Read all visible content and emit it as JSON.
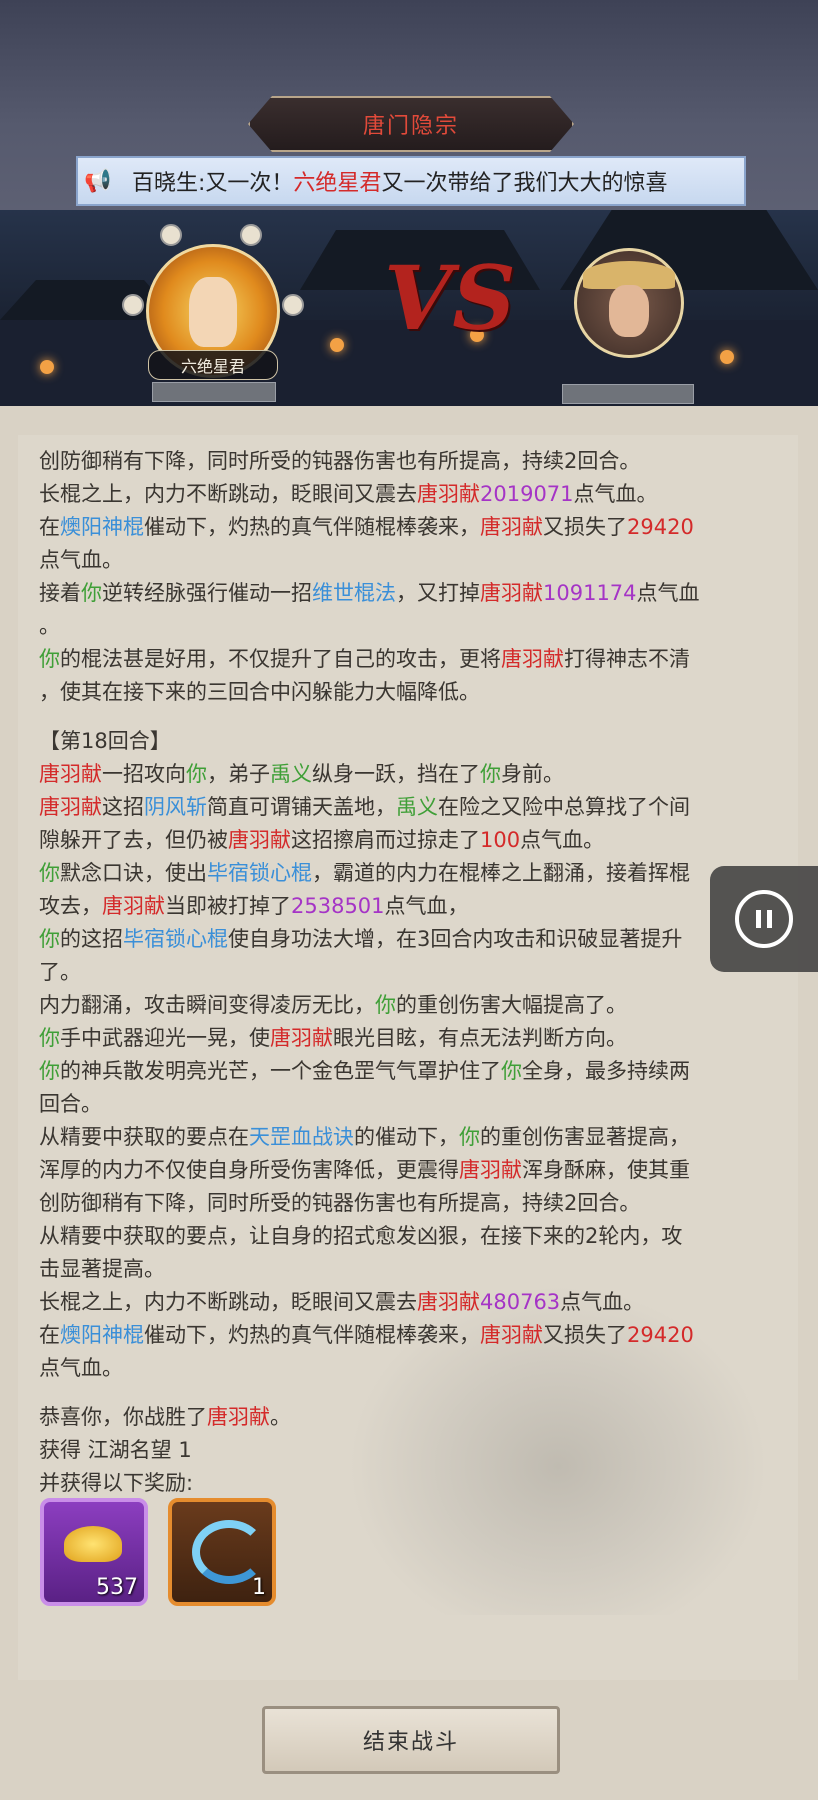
{
  "header": {
    "title": "唐门隐宗",
    "ticker_prefix": "百晓生:又一次！",
    "ticker_name": "六绝星君",
    "ticker_suffix": "又一次带给了我们大大的惊喜"
  },
  "battle": {
    "player_name": "六绝星君",
    "vs_text": "VS"
  },
  "log": {
    "lines": [
      [
        {
          "t": "创防御稍有下降，同时所受的钝器伤害也有所提高，持续2回合。",
          "c": ""
        }
      ],
      [
        {
          "t": "长棍之上，内力不断跳动，眨眼间又震去",
          "c": ""
        },
        {
          "t": "唐羽献",
          "c": "red"
        },
        {
          "t": "2019071",
          "c": "pur"
        },
        {
          "t": "点气血。",
          "c": ""
        }
      ],
      [
        {
          "t": "在",
          "c": ""
        },
        {
          "t": "燠阳神棍",
          "c": "blu"
        },
        {
          "t": "催动下，灼热的真气伴随棍棒袭来，",
          "c": ""
        },
        {
          "t": "唐羽献",
          "c": "red"
        },
        {
          "t": "又损失了",
          "c": ""
        },
        {
          "t": "29420",
          "c": "red"
        }
      ],
      [
        {
          "t": "点气血。",
          "c": ""
        }
      ],
      [
        {
          "t": "接着",
          "c": ""
        },
        {
          "t": "你",
          "c": "grn"
        },
        {
          "t": "逆转经脉强行催动一招",
          "c": ""
        },
        {
          "t": "维世棍法",
          "c": "blu"
        },
        {
          "t": "，又打掉",
          "c": ""
        },
        {
          "t": "唐羽献",
          "c": "red"
        },
        {
          "t": "1091174",
          "c": "pur"
        },
        {
          "t": "点气血",
          "c": ""
        }
      ],
      [
        {
          "t": "。",
          "c": ""
        }
      ],
      [
        {
          "t": "你",
          "c": "grn"
        },
        {
          "t": "的棍法甚是好用，不仅提升了自己的攻击，更将",
          "c": ""
        },
        {
          "t": "唐羽献",
          "c": "red"
        },
        {
          "t": "打得神志不清",
          "c": ""
        }
      ],
      [
        {
          "t": "，使其在接下来的三回合中闪躲能力大幅降低。",
          "c": ""
        }
      ],
      [
        {
          "t": "gap",
          "c": "gap"
        }
      ],
      [
        {
          "t": "【第18回合】",
          "c": ""
        }
      ],
      [
        {
          "t": "唐羽献",
          "c": "red"
        },
        {
          "t": "一招攻向",
          "c": ""
        },
        {
          "t": "你",
          "c": "grn"
        },
        {
          "t": "，弟子",
          "c": ""
        },
        {
          "t": "禹义",
          "c": "grn"
        },
        {
          "t": "纵身一跃，挡在了",
          "c": ""
        },
        {
          "t": "你",
          "c": "grn"
        },
        {
          "t": "身前。",
          "c": ""
        }
      ],
      [
        {
          "t": "唐羽献",
          "c": "red"
        },
        {
          "t": "这招",
          "c": ""
        },
        {
          "t": "阴风斩",
          "c": "blu"
        },
        {
          "t": "简直可谓铺天盖地，",
          "c": ""
        },
        {
          "t": "禹义",
          "c": "grn"
        },
        {
          "t": "在险之又险中总算找了个间",
          "c": ""
        }
      ],
      [
        {
          "t": "隙躲开了去，但仍被",
          "c": ""
        },
        {
          "t": "唐羽献",
          "c": "red"
        },
        {
          "t": "这招擦肩而过掠走了",
          "c": ""
        },
        {
          "t": "100",
          "c": "red"
        },
        {
          "t": "点气血。",
          "c": ""
        }
      ],
      [
        {
          "t": "你",
          "c": "grn"
        },
        {
          "t": "默念口诀，使出",
          "c": ""
        },
        {
          "t": "毕宿锁心棍",
          "c": "blu"
        },
        {
          "t": "，霸道的内力在棍棒之上翻涌，接着挥棍",
          "c": ""
        }
      ],
      [
        {
          "t": "攻去，",
          "c": ""
        },
        {
          "t": "唐羽献",
          "c": "red"
        },
        {
          "t": "当即被打掉了",
          "c": ""
        },
        {
          "t": "2538501",
          "c": "pur"
        },
        {
          "t": "点气血，",
          "c": ""
        }
      ],
      [
        {
          "t": "你",
          "c": "grn"
        },
        {
          "t": "的这招",
          "c": ""
        },
        {
          "t": "毕宿锁心棍",
          "c": "blu"
        },
        {
          "t": "使自身功法大增，在3回合内攻击和识破显著提升",
          "c": ""
        }
      ],
      [
        {
          "t": "了。",
          "c": ""
        }
      ],
      [
        {
          "t": "内力翻涌，攻击瞬间变得凌厉无比，",
          "c": ""
        },
        {
          "t": "你",
          "c": "grn"
        },
        {
          "t": "的重创伤害大幅提高了。",
          "c": ""
        }
      ],
      [
        {
          "t": "你",
          "c": "grn"
        },
        {
          "t": "手中武器迎光一晃，使",
          "c": ""
        },
        {
          "t": "唐羽献",
          "c": "red"
        },
        {
          "t": "眼光目眩，有点无法判断方向。",
          "c": ""
        }
      ],
      [
        {
          "t": "你",
          "c": "grn"
        },
        {
          "t": "的神兵散发明亮光芒，一个金色罡气气罩护住了",
          "c": ""
        },
        {
          "t": "你",
          "c": "grn"
        },
        {
          "t": "全身，最多持续两",
          "c": ""
        }
      ],
      [
        {
          "t": "回合。",
          "c": ""
        }
      ],
      [
        {
          "t": "从精要中获取的要点在",
          "c": ""
        },
        {
          "t": "天罡血战诀",
          "c": "blu"
        },
        {
          "t": "的催动下，",
          "c": ""
        },
        {
          "t": "你",
          "c": "grn"
        },
        {
          "t": "的重创伤害显著提高，",
          "c": ""
        }
      ],
      [
        {
          "t": "浑厚的内力不仅使自身所受伤害降低，更震得",
          "c": ""
        },
        {
          "t": "唐羽献",
          "c": "red"
        },
        {
          "t": "浑身酥麻，使其重",
          "c": ""
        }
      ],
      [
        {
          "t": "创防御稍有下降，同时所受的钝器伤害也有所提高，持续2回合。",
          "c": ""
        }
      ],
      [
        {
          "t": "从精要中获取的要点，让自身的招式愈发凶狠，在接下来的2轮内，攻",
          "c": ""
        }
      ],
      [
        {
          "t": "击显著提高。",
          "c": ""
        }
      ],
      [
        {
          "t": "长棍之上，内力不断跳动，眨眼间又震去",
          "c": ""
        },
        {
          "t": "唐羽献",
          "c": "red"
        },
        {
          "t": "480763",
          "c": "pur"
        },
        {
          "t": "点气血。",
          "c": ""
        }
      ],
      [
        {
          "t": "在",
          "c": ""
        },
        {
          "t": "燠阳神棍",
          "c": "blu"
        },
        {
          "t": "催动下，灼热的真气伴随棍棒袭来，",
          "c": ""
        },
        {
          "t": "唐羽献",
          "c": "red"
        },
        {
          "t": "又损失了",
          "c": ""
        },
        {
          "t": "29420",
          "c": "red"
        }
      ],
      [
        {
          "t": "点气血。",
          "c": ""
        }
      ],
      [
        {
          "t": "gap",
          "c": "gap"
        }
      ],
      [
        {
          "t": "恭喜你，你战胜了",
          "c": ""
        },
        {
          "t": "唐羽献",
          "c": "red"
        },
        {
          "t": "。",
          "c": ""
        }
      ],
      [
        {
          "t": "获得 江湖名望 1",
          "c": ""
        }
      ],
      [
        {
          "t": "并获得以下奖励:",
          "c": ""
        }
      ]
    ]
  },
  "rewards": [
    {
      "icon": "gold-ingot-icon",
      "qty": "537"
    },
    {
      "icon": "blue-swirl-icon",
      "qty": "1"
    }
  ],
  "end_button": "结束战斗",
  "colors": {
    "red": "#d42a2a",
    "green": "#3f9f37",
    "blue": "#3a8fd8",
    "purple": "#a534c6"
  }
}
